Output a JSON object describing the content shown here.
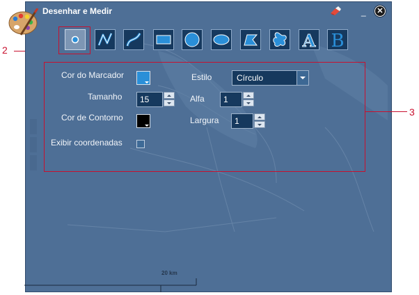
{
  "window": {
    "title": "Desenhar e Medir"
  },
  "tools": [
    {
      "name": "ponto",
      "icon": "point-icon",
      "active": true
    },
    {
      "name": "linha",
      "icon": "polyline-icon",
      "active": false
    },
    {
      "name": "curva",
      "icon": "curve-icon",
      "active": false
    },
    {
      "name": "retangulo",
      "icon": "rectangle-icon",
      "active": false
    },
    {
      "name": "circulo",
      "icon": "circle-icon",
      "active": false
    },
    {
      "name": "elipse",
      "icon": "ellipse-icon",
      "active": false
    },
    {
      "name": "poligono",
      "icon": "polygon-icon",
      "active": false
    },
    {
      "name": "mao-livre",
      "icon": "freehand-icon",
      "active": false
    },
    {
      "name": "texto",
      "icon": "text-a-icon",
      "label": "A",
      "active": false
    },
    {
      "name": "texto-b",
      "icon": "text-b-icon",
      "label": "B",
      "active": false
    }
  ],
  "form": {
    "marker_color_label": "Cor do Marcador",
    "marker_color": "#2a8fd8",
    "size_label": "Tamanho",
    "size_value": "15",
    "outline_color_label": "Cor de Contorno",
    "outline_color": "#000000",
    "show_coords_label": "Exibir coordenadas",
    "style_label": "Estilo",
    "style_value": "Círculo",
    "alpha_label": "Alfa",
    "alpha_value": "1",
    "width_label": "Largura",
    "width_value": "1"
  },
  "callouts": {
    "two": "2",
    "three": "3"
  },
  "scale": {
    "label": "20 km"
  },
  "colors": {
    "panel": "#4e6f96",
    "tool_bg": "#16395e",
    "callout": "#c8102e"
  }
}
